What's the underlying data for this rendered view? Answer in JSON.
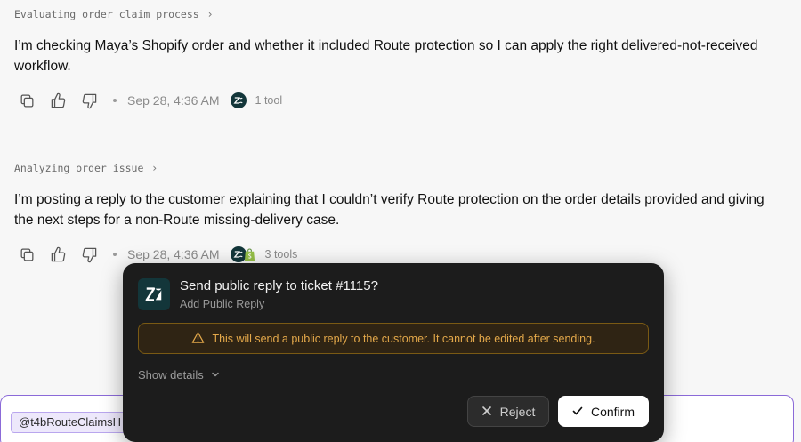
{
  "thread": [
    {
      "step_label": "Evaluating order claim process",
      "message": "I’m checking Maya’s Shopify order and whether it included Route protection so I can apply the right delivered-not-received workflow.",
      "timestamp": "Sep 28, 4:36 AM",
      "tools_label": "1 tool"
    },
    {
      "step_label": "Analyzing order issue",
      "message": "I’m posting a reply to the customer explaining that I couldn’t verify Route protection on the order details provided and giving the next steps for a non-Route missing-delivery case.",
      "timestamp": "Sep 28, 4:36 AM",
      "tools_label": "3 tools"
    }
  ],
  "dialog": {
    "title": "Send public reply to ticket #1115?",
    "subtitle": "Add Public Reply",
    "warning": "This will send a public reply to the customer. It cannot be edited after sending.",
    "details_label": "Show details",
    "reject_label": "Reject",
    "confirm_label": "Confirm"
  },
  "composer": {
    "mention": "@t4bRouteClaimsH"
  },
  "colors": {
    "zendesk_bg": "#13363a",
    "warning_text": "#e3a84a",
    "composer_border": "#8b6ad8",
    "shopify_green": "#95bf47"
  },
  "icons": [
    "copy-icon",
    "thumbs-up-icon",
    "thumbs-down-icon",
    "zendesk-icon",
    "shopify-icon",
    "chevron-right-icon",
    "warning-icon",
    "chevron-down-icon",
    "close-icon",
    "check-icon"
  ]
}
